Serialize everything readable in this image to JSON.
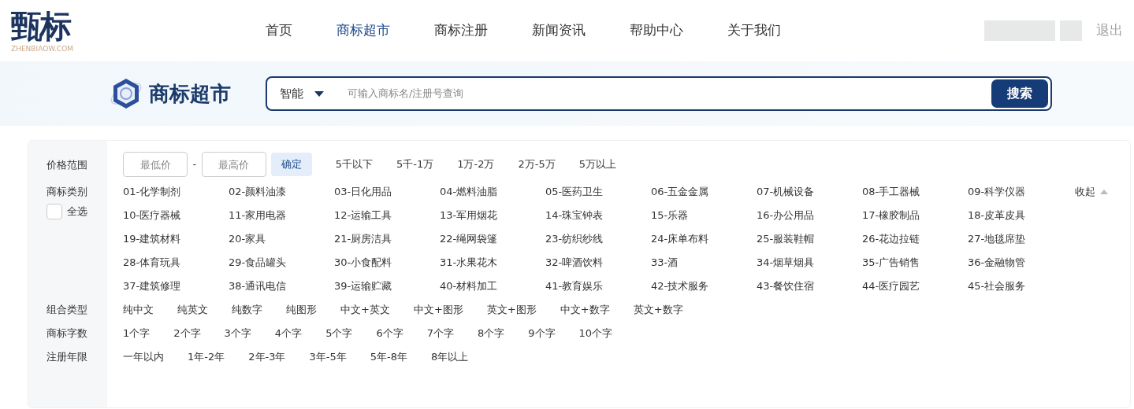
{
  "header": {
    "logo": {
      "text": "甄标",
      "subtitle": "ZHENBIAOW.COM"
    },
    "nav": [
      {
        "label": "首页",
        "selected": false
      },
      {
        "label": "商标超市",
        "selected": true
      },
      {
        "label": "商标注册",
        "selected": false
      },
      {
        "label": "新闻资讯",
        "selected": false
      },
      {
        "label": "帮助中心",
        "selected": false
      },
      {
        "label": "关于我们",
        "selected": false
      }
    ],
    "logout": "退出"
  },
  "search": {
    "brand": "商标超市",
    "mode": "智能",
    "placeholder": "可输入商标名/注册号查询",
    "button": "搜索"
  },
  "filters": {
    "price": {
      "label": "价格范围",
      "min_placeholder": "最低价",
      "separator": "-",
      "max_placeholder": "最高价",
      "confirm": "确定",
      "options": [
        "5千以下",
        "5千-1万",
        "1万-2万",
        "2万-5万",
        "5万以上"
      ]
    },
    "categories": {
      "label": "商标类别",
      "select_all": {
        "label": "全选",
        "checked": false
      },
      "collapse": "收起",
      "items": [
        "01-化学制剂",
        "02-颜料油漆",
        "03-日化用品",
        "04-燃料油脂",
        "05-医药卫生",
        "06-五金金属",
        "07-机械设备",
        "08-手工器械",
        "09-科学仪器",
        "10-医疗器械",
        "11-家用电器",
        "12-运输工具",
        "13-军用烟花",
        "14-珠宝钟表",
        "15-乐器",
        "16-办公用品",
        "17-橡胶制品",
        "18-皮革皮具",
        "19-建筑材料",
        "20-家具",
        "21-厨房洁具",
        "22-绳网袋篷",
        "23-纺织纱线",
        "24-床单布料",
        "25-服装鞋帽",
        "26-花边拉链",
        "27-地毯席垫",
        "28-体育玩具",
        "29-食品罐头",
        "30-小食配料",
        "31-水果花木",
        "32-啤酒饮料",
        "33-酒",
        "34-烟草烟具",
        "35-广告销售",
        "36-金融物管",
        "37-建筑修理",
        "38-通讯电信",
        "39-运输贮藏",
        "40-材料加工",
        "41-教育娱乐",
        "42-技术服务",
        "43-餐饮住宿",
        "44-医疗园艺",
        "45-社会服务"
      ]
    },
    "combination": {
      "label": "组合类型",
      "options": [
        "纯中文",
        "纯英文",
        "纯数字",
        "纯图形",
        "中文+英文",
        "中文+图形",
        "英文+图形",
        "中文+数字",
        "英文+数字"
      ]
    },
    "char_count": {
      "label": "商标字数",
      "options": [
        "1个字",
        "2个字",
        "3个字",
        "4个字",
        "5个字",
        "6个字",
        "7个字",
        "8个字",
        "9个字",
        "10个字"
      ]
    },
    "reg_years": {
      "label": "注册年限",
      "options": [
        "一年以内",
        "1年-2年",
        "2年-3年",
        "3年-5年",
        "5年-8年",
        "8年以上"
      ]
    }
  }
}
